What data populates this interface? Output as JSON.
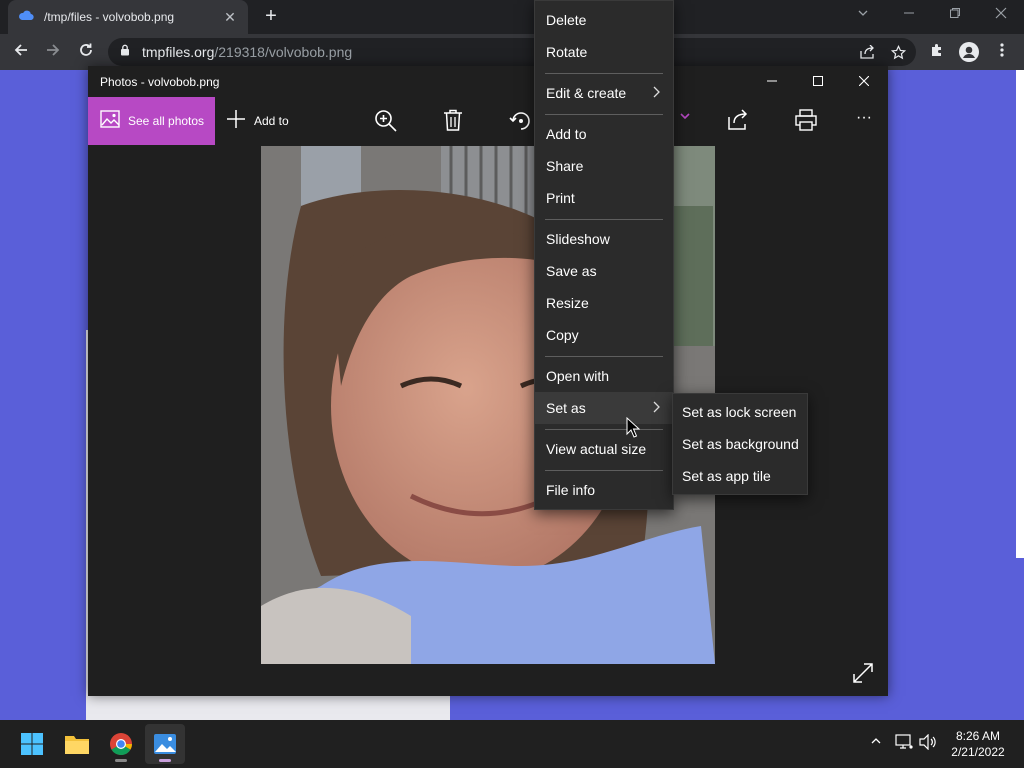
{
  "browser": {
    "tab_title": "/tmp/files - volvobob.png",
    "tab_close": "✕",
    "new_tab": "+",
    "url_host": "tmpfiles.org",
    "url_path": "/219318/volvobob.png"
  },
  "photos": {
    "window_title": "Photos - volvobob.png",
    "see_all_label": "See all photos",
    "add_to_label": "Add to",
    "more_label": "···"
  },
  "context_menu": {
    "items": [
      {
        "label": "Delete"
      },
      {
        "label": "Rotate"
      },
      {
        "label": "Edit & create"
      },
      {
        "label": "Add to"
      },
      {
        "label": "Share"
      },
      {
        "label": "Print"
      },
      {
        "label": "Slideshow"
      },
      {
        "label": "Save as"
      },
      {
        "label": "Resize"
      },
      {
        "label": "Copy"
      },
      {
        "label": "Open with"
      },
      {
        "label": "Set as"
      },
      {
        "label": "View actual size"
      },
      {
        "label": "File info"
      }
    ],
    "submenu": [
      {
        "label": "Set as lock screen"
      },
      {
        "label": "Set as background"
      },
      {
        "label": "Set as app tile"
      }
    ]
  },
  "taskbar": {
    "time": "8:26 AM",
    "date": "2/21/2022"
  },
  "colors": {
    "accent_purple": "#b749c4",
    "page_background": "#5a5fd9",
    "menu_background": "#2b2b2b"
  },
  "icons": [
    "cloud-icon",
    "back-arrow-icon",
    "forward-arrow-icon",
    "reload-icon",
    "lock-icon",
    "share-icon",
    "star-icon",
    "extensions-icon",
    "profile-icon",
    "kebab-menu-icon",
    "photos-icon",
    "zoom-in-icon",
    "trash-icon",
    "rotate-icon",
    "print-icon",
    "expand-icon",
    "chevron-right-icon",
    "windows-start-icon",
    "file-explorer-icon",
    "chrome-icon",
    "photos-app-icon",
    "chevron-up-icon",
    "network-icon",
    "volume-icon"
  ]
}
